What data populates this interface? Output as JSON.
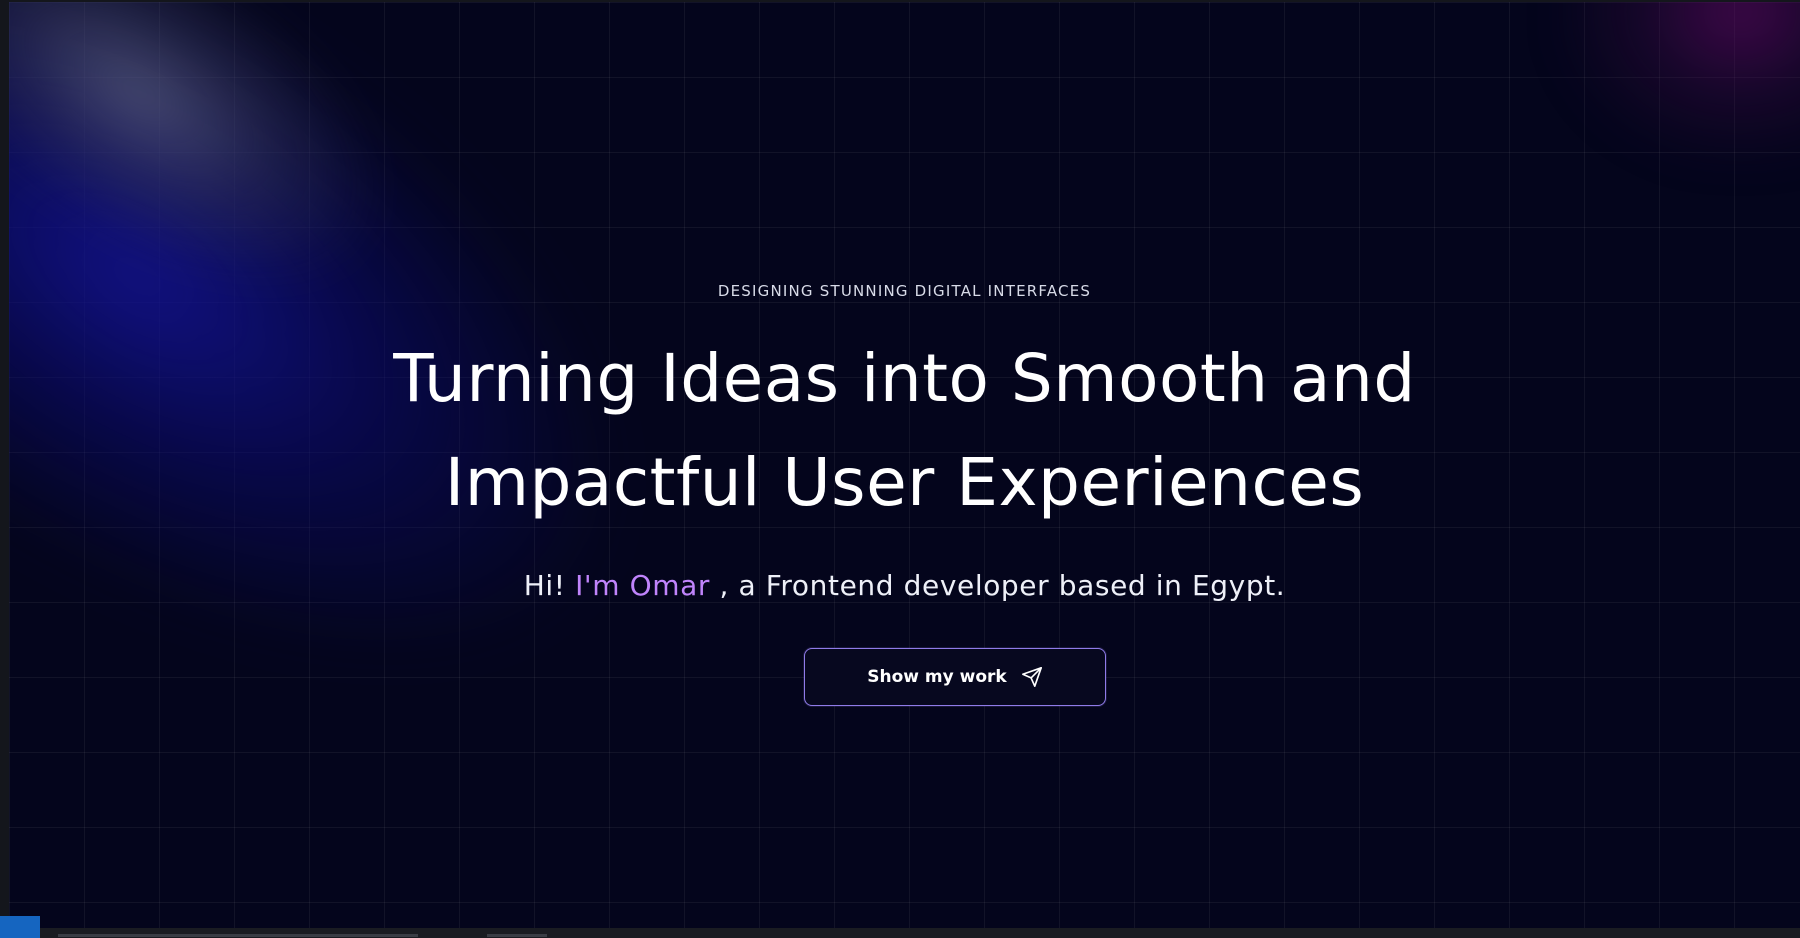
{
  "hero": {
    "eyebrow": "DESIGNING STUNNING DIGITAL INTERFACES",
    "headline_line1": "Turning Ideas into Smooth and",
    "headline_line2": "Impactful User Experiences",
    "intro_prefix": "Hi! ",
    "intro_name": "I'm Omar",
    "intro_suffix": " , a Frontend developer based in Egypt.",
    "cta_label": "Show my work",
    "cta_icon": "paper-plane-icon"
  },
  "colors": {
    "background": "#04051c",
    "accent_name": "#c084fc",
    "cta_border": "#8f7be8",
    "glow_blue": "#0c0c8a",
    "glow_magenta": "#6e0a6e"
  }
}
